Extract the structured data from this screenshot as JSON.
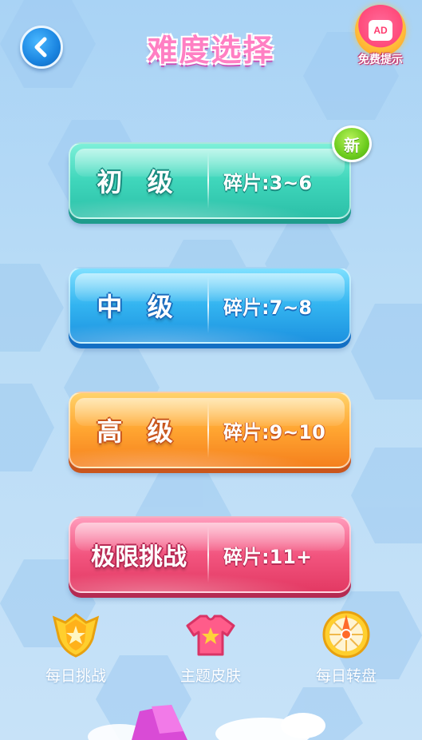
{
  "header": {
    "title": "难度选择",
    "back_icon": "chevron-left-icon",
    "ad": {
      "screen_text": "AD",
      "label": "免费提示",
      "icon": "ad-video-icon"
    }
  },
  "levels": [
    {
      "name": "初 级",
      "pieces": "碎片:3~6",
      "is_new": true,
      "new_label": "新",
      "color": "#3fd6bb"
    },
    {
      "name": "中 级",
      "pieces": "碎片:7~8",
      "is_new": false,
      "color": "#33b4f0"
    },
    {
      "name": "高 级",
      "pieces": "碎片:9~10",
      "is_new": false,
      "color": "#ffa531"
    },
    {
      "name": "极限挑战",
      "pieces": "碎片:11+",
      "is_new": false,
      "color": "#f2557f"
    }
  ],
  "bottom_nav": [
    {
      "label": "每日挑战",
      "icon": "star-shield-icon"
    },
    {
      "label": "主题皮肤",
      "icon": "shirt-icon"
    },
    {
      "label": "每日转盘",
      "icon": "wheel-icon"
    }
  ],
  "colors": {
    "background": "#b9dcf6",
    "title": "#ff7fc3",
    "new_badge": "#6ccc1e"
  }
}
